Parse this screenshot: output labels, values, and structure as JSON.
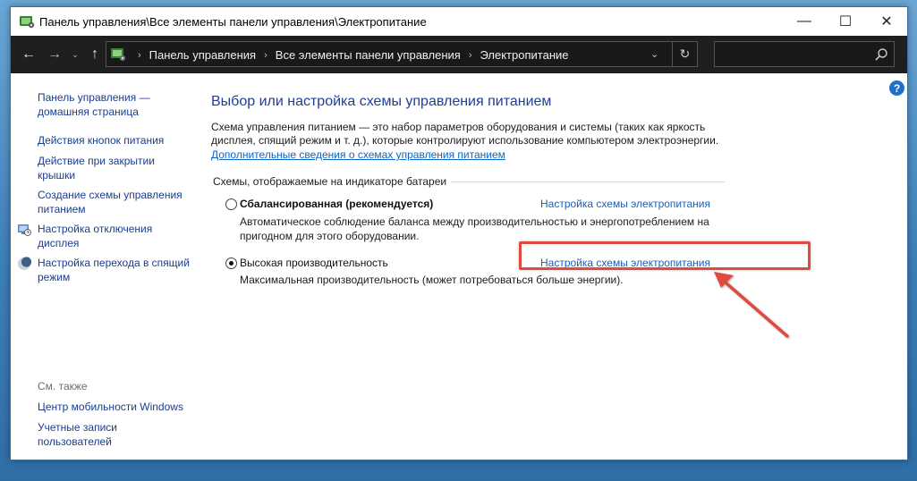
{
  "window": {
    "title": "Панель управления\\Все элементы панели управления\\Электропитание",
    "minimize_glyph": "—",
    "maximize_glyph": "☐",
    "close_glyph": "✕"
  },
  "nav": {
    "back_glyph": "←",
    "forward_glyph": "→",
    "recent_glyph": "⌄",
    "up_glyph": "↑",
    "breadcrumbs": [
      "Панель управления",
      "Все элементы панели управления",
      "Электропитание"
    ],
    "separator": "›",
    "dropdown_glyph": "⌄",
    "refresh_glyph": "↻",
    "search_placeholder": ""
  },
  "sidebar": {
    "home_link": "Панель управления — домашняя страница",
    "links": [
      {
        "label": "Действия кнопок питания",
        "icon": "none"
      },
      {
        "label": "Действие при закрытии крышки",
        "icon": "none"
      },
      {
        "label": "Создание схемы управления питанием",
        "icon": "none"
      },
      {
        "label": "Настройка отключения дисплея",
        "icon": "monitor-clock-icon"
      },
      {
        "label": "Настройка перехода в спящий режим",
        "icon": "moon-icon"
      }
    ],
    "see_also_heading": "См. также",
    "see_also": [
      {
        "label": "Центр мобильности Windows"
      },
      {
        "label": "Учетные записи пользователей"
      }
    ]
  },
  "main": {
    "help_glyph": "?",
    "title": "Выбор или настройка схемы управления питанием",
    "description": "Схема управления питанием — это набор параметров оборудования и системы (таких как яркость дисплея, спящий режим и т. д.), которые контролируют использование компьютером электроэнергии.",
    "more_link": "Дополнительные сведения о схемах управления питанием",
    "section_label": "Схемы, отображаемые на индикаторе батареи",
    "plans": [
      {
        "name": "Сбалансированная (рекомендуется)",
        "selected": false,
        "link": "Настройка схемы электропитания",
        "description": "Автоматическое соблюдение баланса между производительностью и энергопотреблением на пригодном для этого оборудовании."
      },
      {
        "name": "Высокая производительность",
        "selected": true,
        "link": "Настройка схемы электропитания",
        "description": "Максимальная производительность (может потребоваться больше энергии)."
      }
    ]
  },
  "colors": {
    "link": "#1a3d8f",
    "title": "#1e3e9a",
    "annotation": "#e04a3f",
    "address_bar": "#1f1f1f"
  }
}
